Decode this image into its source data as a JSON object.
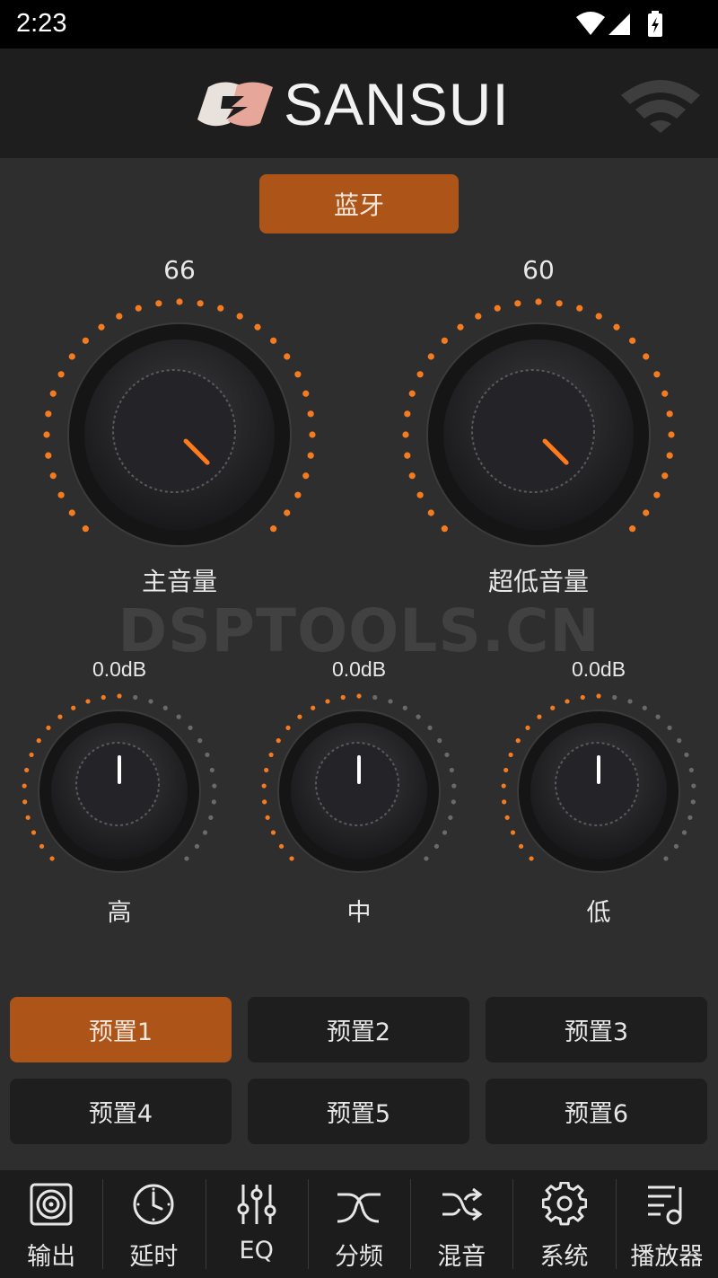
{
  "status": {
    "time": "2:23"
  },
  "header": {
    "brand": "SANSUI"
  },
  "source_button": "蓝牙",
  "main_knobs": [
    {
      "value": "66",
      "label": "主音量"
    },
    {
      "value": "60",
      "label": "超低音量"
    }
  ],
  "watermark": "DSPTOOLS.CN",
  "tone_knobs": [
    {
      "value": "0.0dB",
      "label": "高"
    },
    {
      "value": "0.0dB",
      "label": "中"
    },
    {
      "value": "0.0dB",
      "label": "低"
    }
  ],
  "presets": [
    {
      "label": "预置1",
      "active": true
    },
    {
      "label": "预置2",
      "active": false
    },
    {
      "label": "预置3",
      "active": false
    },
    {
      "label": "预置4",
      "active": false
    },
    {
      "label": "预置5",
      "active": false
    },
    {
      "label": "预置6",
      "active": false
    }
  ],
  "nav": [
    {
      "label": "输出",
      "icon": "speaker-icon"
    },
    {
      "label": "延时",
      "icon": "clock-icon"
    },
    {
      "label": "EQ",
      "icon": "equalizer-icon"
    },
    {
      "label": "分频",
      "icon": "crossover-icon"
    },
    {
      "label": "混音",
      "icon": "shuffle-icon"
    },
    {
      "label": "系统",
      "icon": "gear-icon"
    },
    {
      "label": "播放器",
      "icon": "playlist-icon"
    }
  ],
  "colors": {
    "accent": "#ad5518",
    "dot_active": "#f47b20",
    "dot_inactive": "#6a6a6a"
  }
}
